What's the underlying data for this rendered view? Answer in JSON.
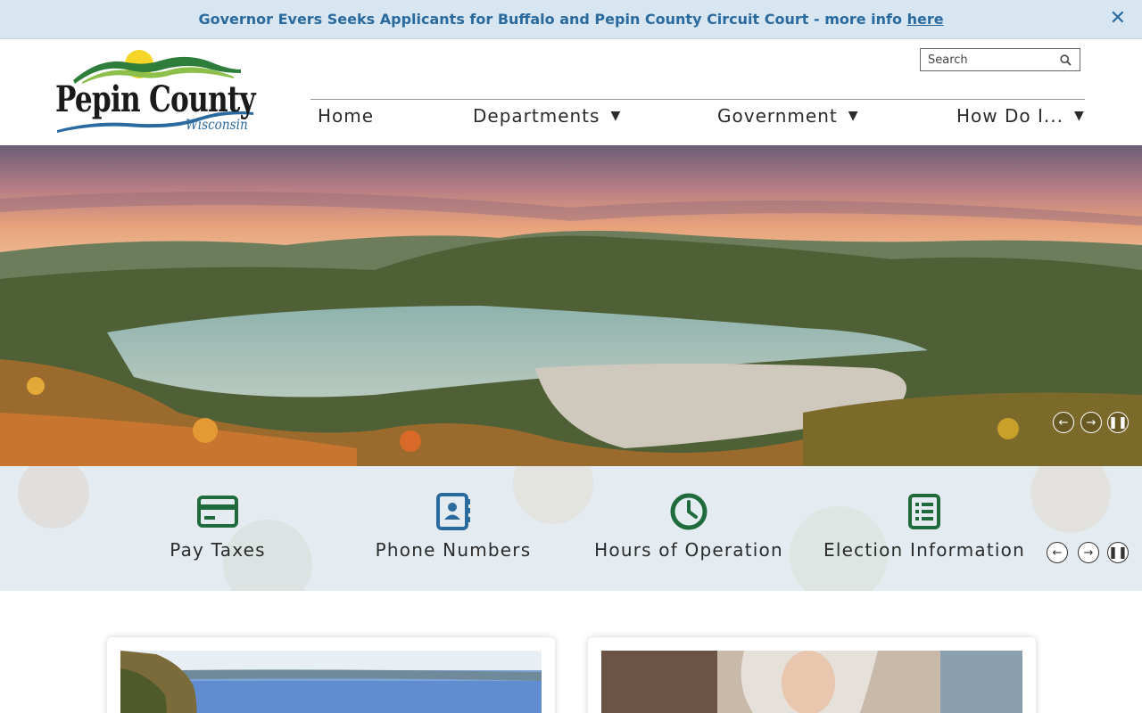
{
  "alert": {
    "text": "Governor Evers Seeks Applicants for Buffalo and Pepin County Circuit Court - more info ",
    "link_text": "here",
    "close_symbol": "✕"
  },
  "logo": {
    "main": "Pepin County",
    "sub": "Wisconsin"
  },
  "search": {
    "placeholder": "Search"
  },
  "nav": {
    "items": [
      {
        "label": "Home",
        "caret": ""
      },
      {
        "label": "Departments",
        "caret": "▼"
      },
      {
        "label": "Government",
        "caret": "▼"
      },
      {
        "label": "How Do I...",
        "caret": "▼"
      }
    ]
  },
  "hero": {
    "controls": [
      "prev",
      "next",
      "pause"
    ]
  },
  "quick_links": {
    "items": [
      {
        "label": "Pay Taxes",
        "icon": "credit-card-icon"
      },
      {
        "label": "Phone Numbers",
        "icon": "contact-book-icon"
      },
      {
        "label": "Hours of Operation",
        "icon": "clock-icon"
      },
      {
        "label": "Election Information",
        "icon": "list-document-icon"
      }
    ]
  },
  "colors": {
    "accent_blue": "#2a6a9e",
    "accent_green": "#1f6b3b",
    "alert_bg": "#d7e6f0"
  }
}
